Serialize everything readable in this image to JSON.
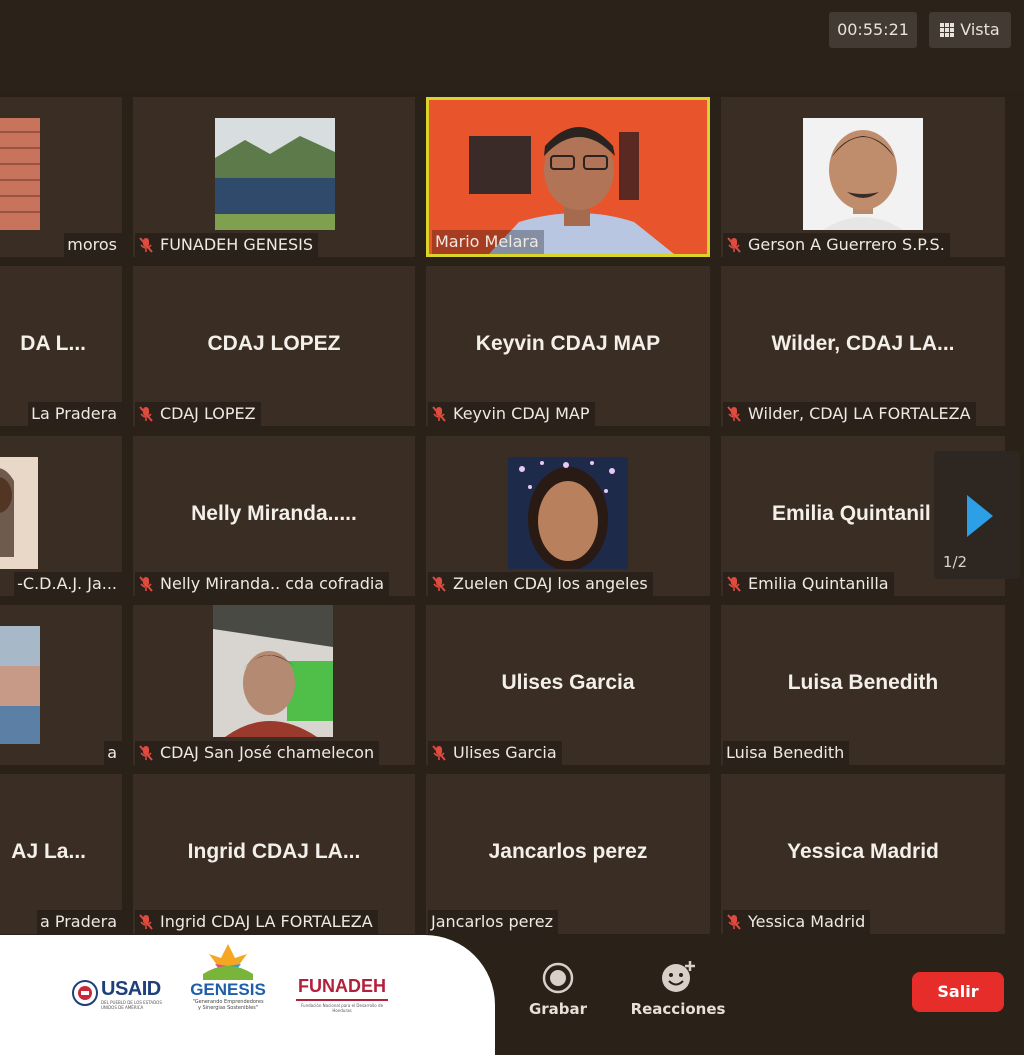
{
  "header": {
    "timer": "00:55:21",
    "view_label": "Vista"
  },
  "tiles": [
    {
      "big": "",
      "label": "moros",
      "muted": false
    },
    {
      "big": "",
      "label": "FUNADEH GENESIS",
      "muted": true
    },
    {
      "big": "",
      "label": "Mario Melara",
      "muted": false
    },
    {
      "big": "",
      "label": "Gerson A Guerrero S.P.S.",
      "muted": true
    },
    {
      "big": "DA L...",
      "label": "La Pradera",
      "muted": false
    },
    {
      "big": "CDAJ LOPEZ",
      "label": "CDAJ LOPEZ",
      "muted": true
    },
    {
      "big": "Keyvin CDAJ MAP",
      "label": "Keyvin CDAJ MAP",
      "muted": true
    },
    {
      "big": "Wilder, CDAJ LA...",
      "label": "Wilder, CDAJ LA FORTALEZA",
      "muted": true
    },
    {
      "big": "",
      "label": "-C.D.A.J. Ja...",
      "muted": false
    },
    {
      "big": "Nelly Miranda.....",
      "label": "Nelly Miranda.. cda cofradia",
      "muted": true
    },
    {
      "big": "",
      "label": "Zuelen CDAJ los angeles",
      "muted": true
    },
    {
      "big": "Emilia Quintanil",
      "label": "Emilia Quintanilla",
      "muted": true
    },
    {
      "big": "",
      "label": "a",
      "muted": false
    },
    {
      "big": "",
      "label": "CDAJ San José chamelecon",
      "muted": true
    },
    {
      "big": "Ulises Garcia",
      "label": "Ulises Garcia",
      "muted": true
    },
    {
      "big": "Luisa Benedith",
      "label": "Luisa Benedith",
      "muted": false
    },
    {
      "big": "AJ La...",
      "label": "a Pradera",
      "muted": false
    },
    {
      "big": "Ingrid CDAJ LA...",
      "label": "Ingrid CDAJ LA FORTALEZA",
      "muted": true
    },
    {
      "big": "Jancarlos perez",
      "label": "Jancarlos perez",
      "muted": false
    },
    {
      "big": "Yessica Madrid",
      "label": "Yessica Madrid",
      "muted": true
    }
  ],
  "pagination": {
    "page": "1/2"
  },
  "controls": {
    "record": "Grabar",
    "reactions": "Reacciones",
    "leave": "Salir"
  },
  "logos": {
    "usaid": "USAID",
    "usaid_sub": "DEL PUEBLO DE LOS ESTADOS UNIDOS DE AMÉRICA",
    "genesis": "GENESIS",
    "genesis_sub": "\"Generando Emprendedores y Sinergias Sostenibles\"",
    "funadeh": "FUNADEH",
    "funadeh_sub": "Fundación Nacional para el Desarrollo de Honduras"
  },
  "colors": {
    "active_speaker": "#d9d32b",
    "muted_icon": "#e04b3f",
    "leave_button": "#e62d2a"
  }
}
